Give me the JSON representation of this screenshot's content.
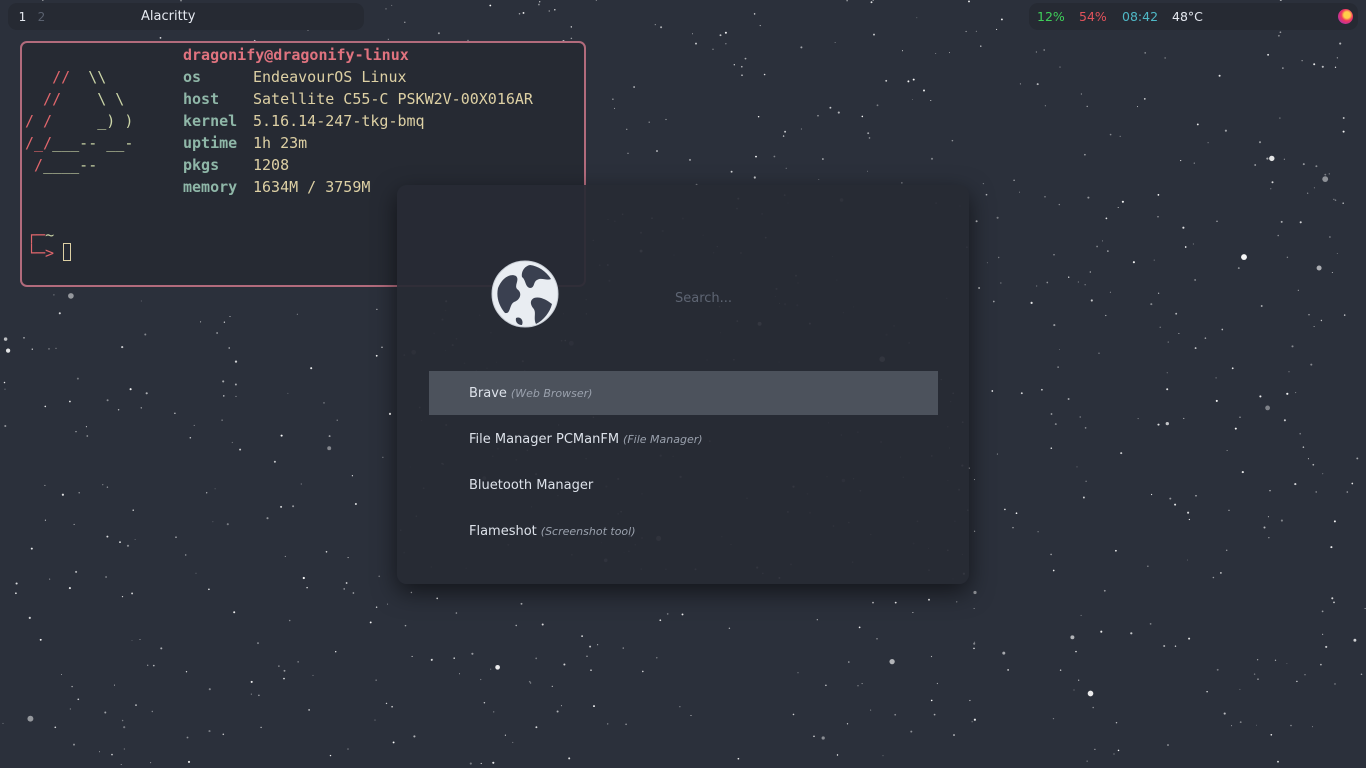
{
  "topbar": {
    "workspaces": [
      {
        "label": "1",
        "active": true
      },
      {
        "label": "2",
        "active": false
      }
    ],
    "window_title": "Alacritty",
    "status": {
      "cpu": "12%",
      "memory": "54%",
      "clock": "08:42",
      "temperature": "48°C",
      "tray_icon": "firefox-icon"
    }
  },
  "terminal": {
    "user_host": "dragonify@dragonify-linux",
    "logo_lines": [
      {
        "red": "   //  ",
        "green": "\\\\"
      },
      {
        "red": "  //    ",
        "green": "\\ \\"
      },
      {
        "red": "/ /     ",
        "green": "_) )"
      },
      {
        "red": "/_/",
        "green": "___-- __-"
      },
      {
        "red": " /",
        "green": "____--"
      }
    ],
    "fetch": [
      {
        "label": "os",
        "value": "EndeavourOS Linux"
      },
      {
        "label": "host",
        "value": "Satellite C55-C PSKW2V-00X016AR"
      },
      {
        "label": "kernel",
        "value": "5.16.14-247-tkg-bmq"
      },
      {
        "label": "uptime",
        "value": "1h 23m"
      },
      {
        "label": "pkgs",
        "value": "1208"
      },
      {
        "label": "memory",
        "value": "1634M / 3759M"
      }
    ],
    "prompt": {
      "line1": "┌─",
      "dir": "~",
      "line2": "└─>"
    }
  },
  "launcher": {
    "logo_icon": "earth-globe-icon",
    "search_placeholder": "Search...",
    "entries": [
      {
        "name": "Brave",
        "desc": "(Web Browser)",
        "selected": true
      },
      {
        "name": "File Manager PCManFM",
        "desc": "(File Manager)",
        "selected": false
      },
      {
        "name": "Bluetooth Manager",
        "desc": "",
        "selected": false
      },
      {
        "name": "Flameshot",
        "desc": "(Screenshot tool)",
        "selected": false
      }
    ]
  },
  "colors": {
    "desktop_bg": "#2b303b",
    "bar_bg": "#262a33",
    "terminal_border": "#b26b7c",
    "cpu": "#3fcf5a",
    "memory": "#e0525b",
    "clock": "#4fb8c6",
    "selected_entry": "#4c525c"
  }
}
